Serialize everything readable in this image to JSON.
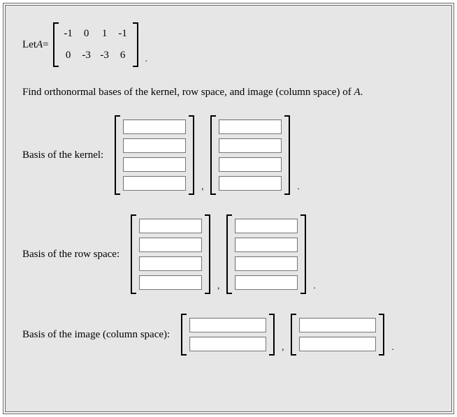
{
  "problem": {
    "let_prefix": "Let ",
    "var": "A",
    "equals": " = ",
    "matrix": [
      [
        "-1",
        "0",
        "1",
        "-1"
      ],
      [
        "0",
        "-3",
        "-3",
        "6"
      ]
    ],
    "period": ".",
    "instruction_pre": "Find orthonormal bases of the kernel, row space, and image (column space) of ",
    "instruction_var": "A",
    "instruction_post": "."
  },
  "sections": {
    "kernel": {
      "label": "Basis of the kernel:",
      "vec_size": 4,
      "num_vectors": 2,
      "comma": ",",
      "period": "."
    },
    "row_space": {
      "label": "Basis of the row space:",
      "vec_size": 4,
      "num_vectors": 2,
      "comma": ",",
      "period": "."
    },
    "image": {
      "label": "Basis of the image (column space):",
      "vec_size": 2,
      "num_vectors": 2,
      "comma": ",",
      "period": "."
    }
  }
}
